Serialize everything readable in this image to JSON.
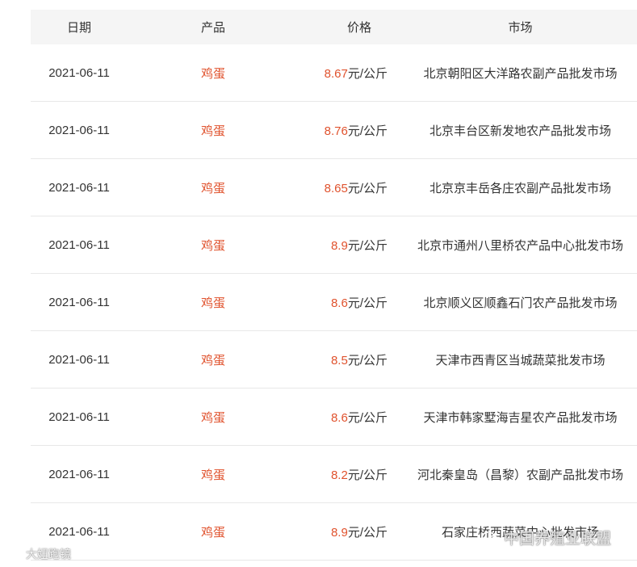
{
  "table": {
    "headers": {
      "date": "日期",
      "product": "产品",
      "price": "价格",
      "market": "市场"
    },
    "rows": [
      {
        "date": "2021-06-11",
        "product": "鸡蛋",
        "price": "8.67",
        "unit": "元/公斤",
        "market": "北京朝阳区大洋路农副产品批发市场"
      },
      {
        "date": "2021-06-11",
        "product": "鸡蛋",
        "price": "8.76",
        "unit": "元/公斤",
        "market": "北京丰台区新发地农产品批发市场"
      },
      {
        "date": "2021-06-11",
        "product": "鸡蛋",
        "price": "8.65",
        "unit": "元/公斤",
        "market": "北京京丰岳各庄农副产品批发市场"
      },
      {
        "date": "2021-06-11",
        "product": "鸡蛋",
        "price": "8.9",
        "unit": "元/公斤",
        "market": "北京市通州八里桥农产品中心批发市场"
      },
      {
        "date": "2021-06-11",
        "product": "鸡蛋",
        "price": "8.6",
        "unit": "元/公斤",
        "market": "北京顺义区顺鑫石门农产品批发市场"
      },
      {
        "date": "2021-06-11",
        "product": "鸡蛋",
        "price": "8.5",
        "unit": "元/公斤",
        "market": "天津市西青区当城蔬菜批发市场"
      },
      {
        "date": "2021-06-11",
        "product": "鸡蛋",
        "price": "8.6",
        "unit": "元/公斤",
        "market": "天津市韩家墅海吉星农产品批发市场"
      },
      {
        "date": "2021-06-11",
        "product": "鸡蛋",
        "price": "8.2",
        "unit": "元/公斤",
        "market": "河北秦皇岛（昌黎）农副产品批发市场"
      },
      {
        "date": "2021-06-11",
        "product": "鸡蛋",
        "price": "8.9",
        "unit": "元/公斤",
        "market": "石家庄桥西蔬菜中心批发市场"
      }
    ]
  },
  "watermarks": {
    "left": "大妞跑镜",
    "right": "中国养殖业联盟"
  },
  "colors": {
    "accent": "#e0522d",
    "header_bg": "#f5f5f5",
    "text": "#333333",
    "divider": "#e8e8e8"
  }
}
